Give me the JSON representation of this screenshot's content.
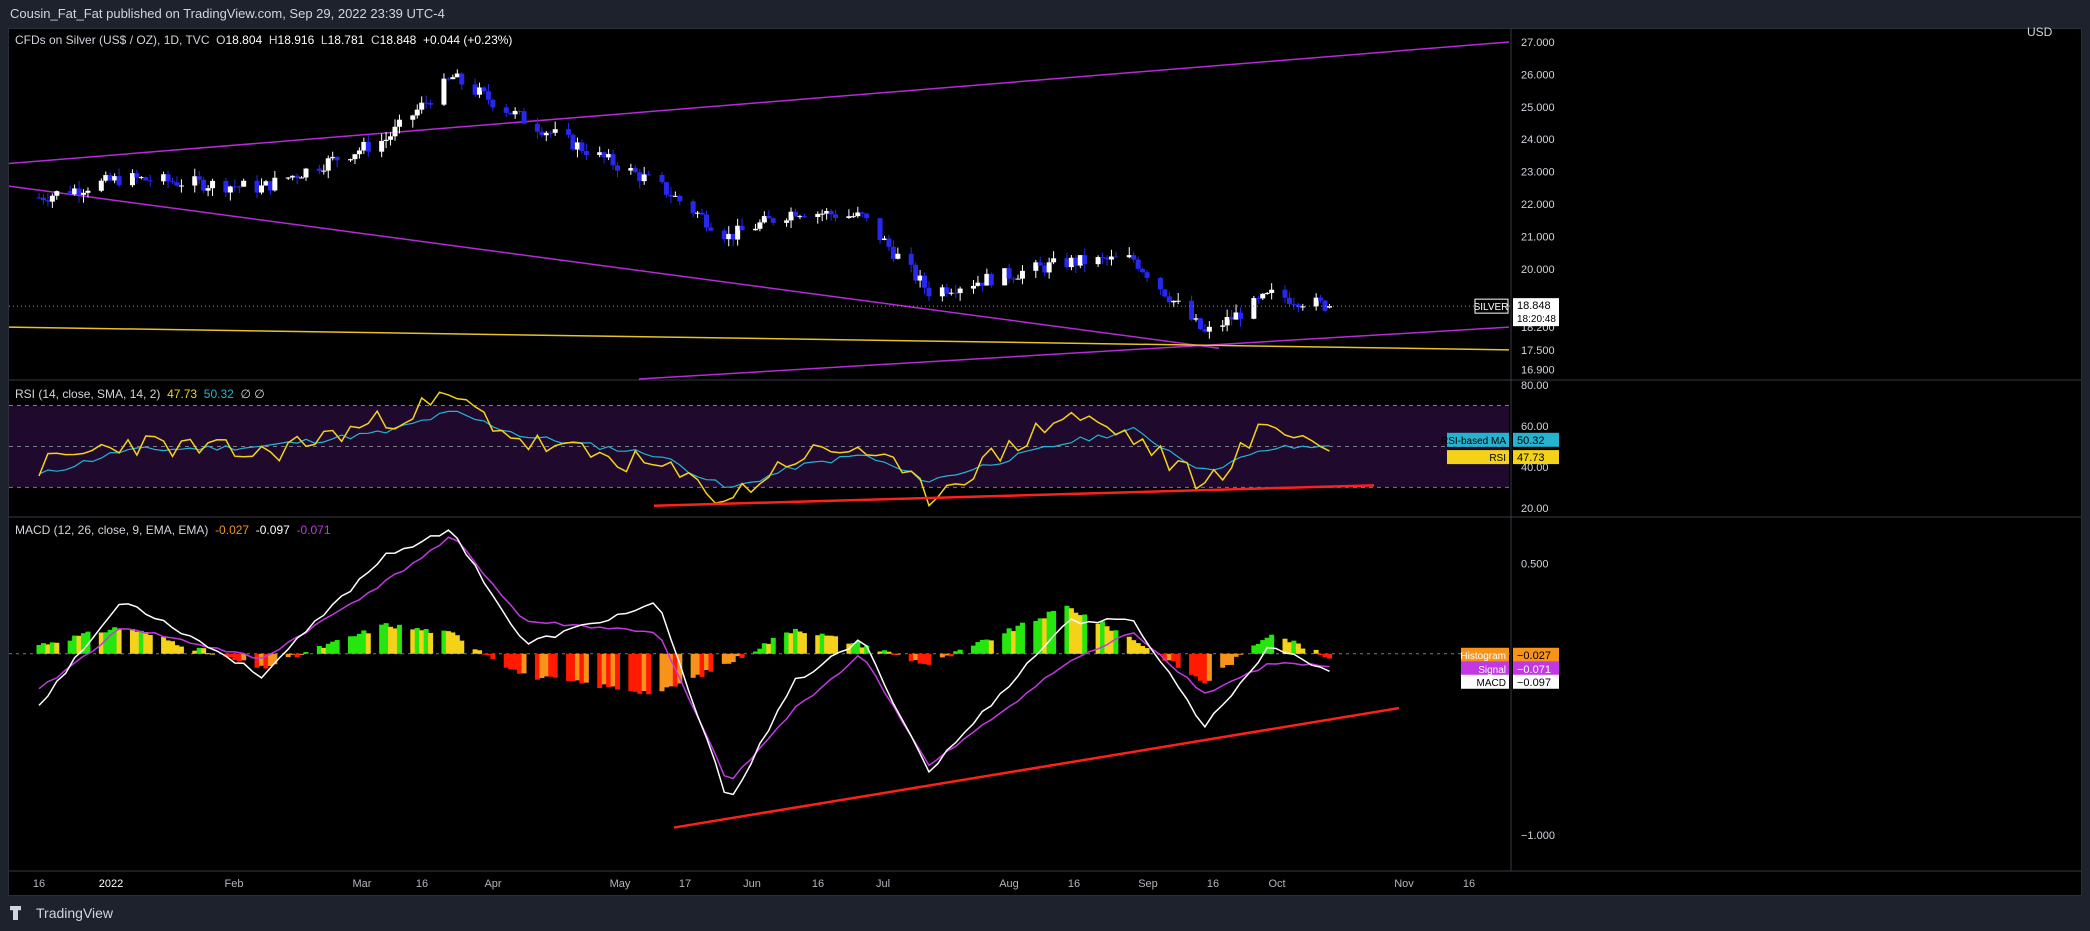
{
  "header": {
    "publisher_line": "Cousin_Fat_Fat published on TradingView.com, Sep 29, 2022 23:39 UTC-4"
  },
  "footer": {
    "brand": "TradingView"
  },
  "main": {
    "title": "CFDs on Silver (US$ / OZ), 1D, TVC",
    "ohlc": {
      "o_label": "O",
      "o": "18.804",
      "h_label": "H",
      "h": "18.916",
      "l_label": "L",
      "l": "18.781",
      "c_label": "C",
      "c": "18.848",
      "change": "+0.044 (+0.23%)"
    },
    "currency": "USD",
    "price_ticks": [
      "27.000",
      "26.000",
      "25.000",
      "24.000",
      "23.000",
      "22.000",
      "21.000",
      "20.000",
      "18.200",
      "17.500",
      "16.900"
    ],
    "last_price_badge": {
      "symbol": "SILVER",
      "price": "18.848",
      "countdown": "18:20:48"
    }
  },
  "rsi": {
    "title": "RSI (14, close, SMA, 14, 2)",
    "rsi_value": "47.73",
    "ma_value": "50.32",
    "extra": "∅ ∅",
    "ticks": [
      "80.00",
      "60.00",
      "40.00",
      "20.00"
    ],
    "labels": {
      "ma_name": "RSI-based MA",
      "ma_val": "50.32",
      "rsi_name": "RSI",
      "rsi_val": "47.73"
    }
  },
  "macd": {
    "title": "MACD (12, 26, close, 9, EMA, EMA)",
    "hist_value": "-0.027",
    "macd_value": "-0.097",
    "signal_value": "-0.071",
    "ticks": [
      "0.500",
      "−1.000"
    ],
    "labels": {
      "hist_name": "Histogram",
      "hist_val": "−0.027",
      "signal_name": "Signal",
      "signal_val": "−0.071",
      "macd_name": "MACD",
      "macd_val": "−0.097"
    }
  },
  "time_axis": [
    "16",
    "2022",
    "Feb",
    "Mar",
    "16",
    "Apr",
    "May",
    "17",
    "Jun",
    "16",
    "Jul",
    "Aug",
    "16",
    "Sep",
    "16",
    "Oct",
    "Nov",
    "16"
  ],
  "colors": {
    "up": "#ffffff",
    "down": "#2727ee",
    "trendline": "#b52bd6",
    "support": "#e6c229",
    "divergence": "#ff1f1f",
    "rsi": "#f4d21a",
    "rsi_ma": "#26b3d0",
    "rsi_band": "#1f0a2e",
    "macd": "#ffffff",
    "signal": "#c239e3"
  },
  "chart_data": [
    {
      "type": "candlestick",
      "title": "CFDs on Silver (US$ / OZ), 1D, TVC",
      "x": [
        "2021-12-13",
        "2022-01-01",
        "2022-02-01",
        "2022-03-01",
        "2022-03-16",
        "2022-04-01",
        "2022-05-01",
        "2022-05-17",
        "2022-06-01",
        "2022-06-16",
        "2022-07-01",
        "2022-08-01",
        "2022-08-16",
        "2022-09-01",
        "2022-09-16",
        "2022-09-29"
      ],
      "close": [
        22.2,
        22.8,
        22.5,
        24.0,
        25.9,
        24.6,
        22.6,
        21.0,
        21.8,
        21.6,
        19.3,
        20.2,
        20.3,
        18.0,
        19.2,
        18.848
      ],
      "ylim": [
        16.6,
        27.4
      ],
      "last": {
        "open": 18.804,
        "high": 18.916,
        "low": 18.781,
        "close": 18.848
      }
    },
    {
      "type": "line",
      "title": "RSI (14, close, SMA, 14, 2)",
      "x": [
        "2021-12-13",
        "2022-01-01",
        "2022-02-01",
        "2022-03-01",
        "2022-03-16",
        "2022-04-01",
        "2022-05-01",
        "2022-05-17",
        "2022-06-01",
        "2022-06-16",
        "2022-07-01",
        "2022-08-01",
        "2022-08-16",
        "2022-09-01",
        "2022-09-16",
        "2022-09-29"
      ],
      "series": [
        {
          "name": "RSI",
          "values": [
            40,
            52,
            46,
            63,
            74,
            52,
            40,
            24,
            45,
            50,
            26,
            66,
            54,
            31,
            62,
            47.73
          ]
        },
        {
          "name": "RSI-based MA",
          "values": [
            36,
            48,
            50,
            57,
            67,
            55,
            46,
            29,
            40,
            46,
            33,
            52,
            58,
            38,
            49,
            50.32
          ]
        }
      ],
      "ylim": [
        16,
        82
      ]
    },
    {
      "type": "bar+line",
      "title": "MACD (12, 26, close, 9, EMA, EMA)",
      "x": [
        "2021-12-13",
        "2022-01-01",
        "2022-02-01",
        "2022-03-01",
        "2022-03-16",
        "2022-04-01",
        "2022-05-01",
        "2022-05-17",
        "2022-06-01",
        "2022-06-16",
        "2022-07-01",
        "2022-08-01",
        "2022-08-16",
        "2022-09-01",
        "2022-09-16",
        "2022-09-29"
      ],
      "series": [
        {
          "name": "Histogram",
          "values": [
            0.05,
            0.15,
            -0.08,
            0.16,
            0.11,
            -0.12,
            -0.22,
            -0.05,
            0.14,
            0.05,
            -0.06,
            0.26,
            0.08,
            -0.16,
            0.12,
            -0.027
          ]
        },
        {
          "name": "Signal",
          "values": [
            -0.2,
            0.15,
            -0.03,
            0.4,
            0.65,
            0.18,
            0.12,
            -0.72,
            -0.3,
            0.0,
            -0.62,
            -0.05,
            0.12,
            -0.22,
            -0.05,
            -0.071
          ]
        },
        {
          "name": "MACD",
          "values": [
            -0.28,
            0.3,
            -0.12,
            0.55,
            0.68,
            0.05,
            0.28,
            -0.82,
            -0.15,
            0.08,
            -0.65,
            0.18,
            0.18,
            -0.4,
            0.05,
            -0.097
          ]
        }
      ],
      "ylim": [
        -1.2,
        0.75
      ]
    }
  ]
}
